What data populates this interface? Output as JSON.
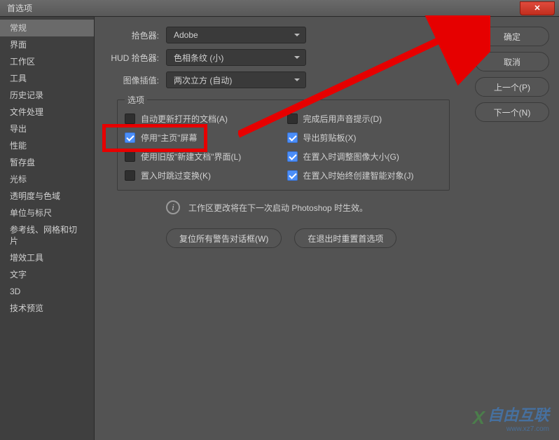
{
  "title": "首选项",
  "sidebar": {
    "items": [
      "常规",
      "界面",
      "工作区",
      "工具",
      "历史记录",
      "文件处理",
      "导出",
      "性能",
      "暂存盘",
      "光标",
      "透明度与色域",
      "单位与标尺",
      "参考线、网格和切片",
      "增效工具",
      "文字",
      "3D",
      "技术预览"
    ],
    "active_index": 0
  },
  "form": {
    "picker_label": "拾色器:",
    "picker_value": "Adobe",
    "hud_label": "HUD 拾色器:",
    "hud_value": "色相条纹 (小)",
    "interp_label": "图像插值:",
    "interp_value": "两次立方 (自动)"
  },
  "options_legend": "选项",
  "checks": {
    "left": [
      {
        "label": "自动更新打开的文档(A)",
        "checked": false
      },
      {
        "label": "停用\"主页\"屏幕",
        "checked": true
      },
      {
        "label": "使用旧版\"新建文档\"界面(L)",
        "checked": false
      },
      {
        "label": "置入时跳过变换(K)",
        "checked": false
      }
    ],
    "right": [
      {
        "label": "完成后用声音提示(D)",
        "checked": false
      },
      {
        "label": "导出剪贴板(X)",
        "checked": true
      },
      {
        "label": "在置入时调整图像大小(G)",
        "checked": true
      },
      {
        "label": "在置入时始终创建智能对象(J)",
        "checked": true
      }
    ]
  },
  "info_text": "工作区更改将在下一次启动 Photoshop 时生效。",
  "bottom_buttons": {
    "reset_warnings": "复位所有警告对话框(W)",
    "reset_on_quit": "在退出时重置首选项"
  },
  "right_buttons": {
    "ok": "确定",
    "cancel": "取消",
    "prev": "上一个(P)",
    "next": "下一个(N)"
  },
  "watermark": {
    "text": "自由互联",
    "sub": "www.xz7.com"
  }
}
